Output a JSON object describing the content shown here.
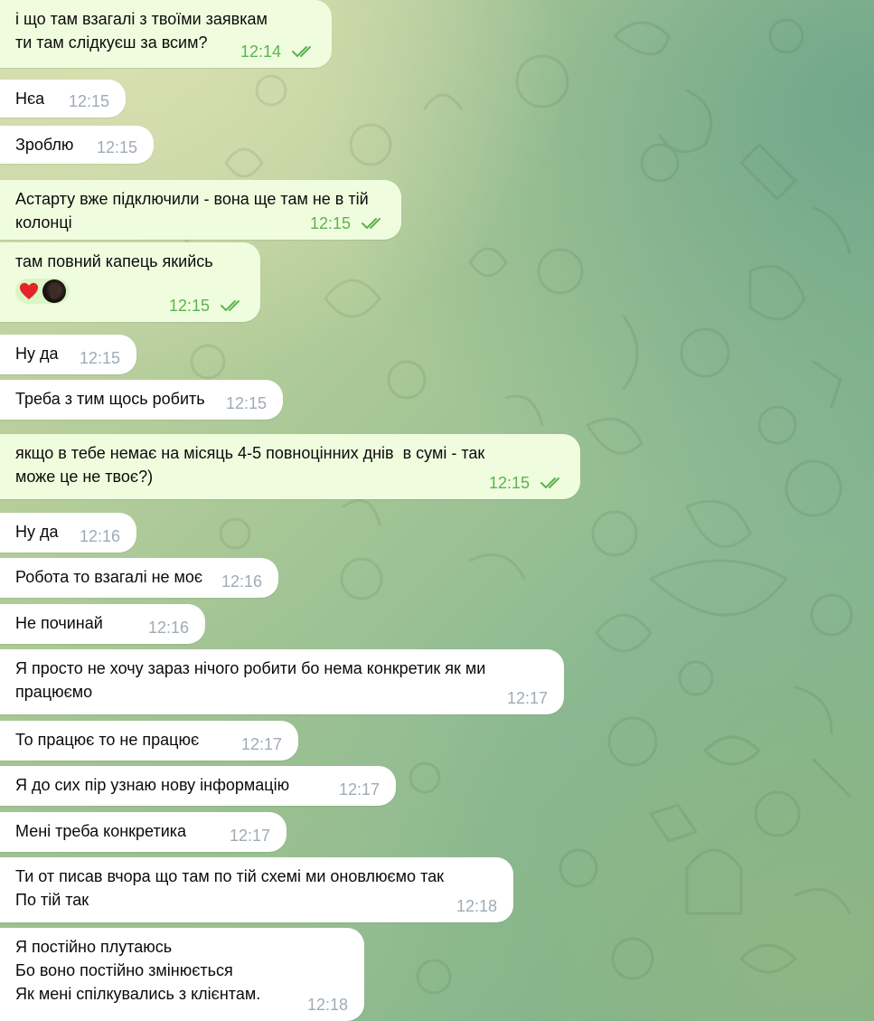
{
  "messages": [
    {
      "dir": "out",
      "text": "і що там взагалі з твоїми заявкам\nти там слідкуєш за всим?",
      "time": "12:14",
      "read": true
    },
    {
      "dir": "in",
      "text": "Нєа",
      "time": "12:15"
    },
    {
      "dir": "in",
      "text": "Зроблю",
      "time": "12:15"
    },
    {
      "dir": "out",
      "text": "Астарту вже підключили - вона ще там не в тій колонці",
      "time": "12:15",
      "read": true
    },
    {
      "dir": "out",
      "text": "там повний капець якийсь",
      "time": "12:15",
      "read": true,
      "reactions": [
        {
          "emoji": "heart",
          "avatar": "user-avatar"
        }
      ]
    },
    {
      "dir": "in",
      "text": "Ну да",
      "time": "12:15"
    },
    {
      "dir": "in",
      "text": "Треба з тим щось робить",
      "time": "12:15"
    },
    {
      "dir": "out",
      "text": "якщо в тебе немає на місяць 4-5 повноцінних днів  в сумі - так\nможе це не твоє?)",
      "time": "12:15",
      "read": true
    },
    {
      "dir": "in",
      "text": "Ну да",
      "time": "12:16"
    },
    {
      "dir": "in",
      "text": "Робота то взагалі не моє",
      "time": "12:16"
    },
    {
      "dir": "in",
      "text": "Не починай",
      "time": "12:16"
    },
    {
      "dir": "in",
      "text": "Я просто не хочу зараз нічого робити бо нема конкретик як ми\nпрацюємо",
      "time": "12:17"
    },
    {
      "dir": "in",
      "text": "То працює то не працює",
      "time": "12:17"
    },
    {
      "dir": "in",
      "text": "Я до сих пір узнаю нову інформацію",
      "time": "12:17"
    },
    {
      "dir": "in",
      "text": "Мені треба конкретика",
      "time": "12:17"
    },
    {
      "dir": "in",
      "text": "Ти от писав вчора що там по тій схемі ми оновлюємо так\nПо тій так",
      "time": "12:18"
    },
    {
      "dir": "in",
      "text": "Я постійно плутаюсь\nБо воно постійно змінюється\nЯк мені спілкувались з клієнтам.",
      "time": "12:18"
    }
  ],
  "colors": {
    "outgoing_bubble": "#effdde",
    "incoming_bubble": "#ffffff",
    "outgoing_time": "#5eb24f",
    "incoming_time": "#a0abb5",
    "read_checks": "#5eb24f",
    "reaction_heart": "#e5242a"
  },
  "icons": {
    "read_receipt": "double-check-icon",
    "reaction": "heart-emoji"
  }
}
